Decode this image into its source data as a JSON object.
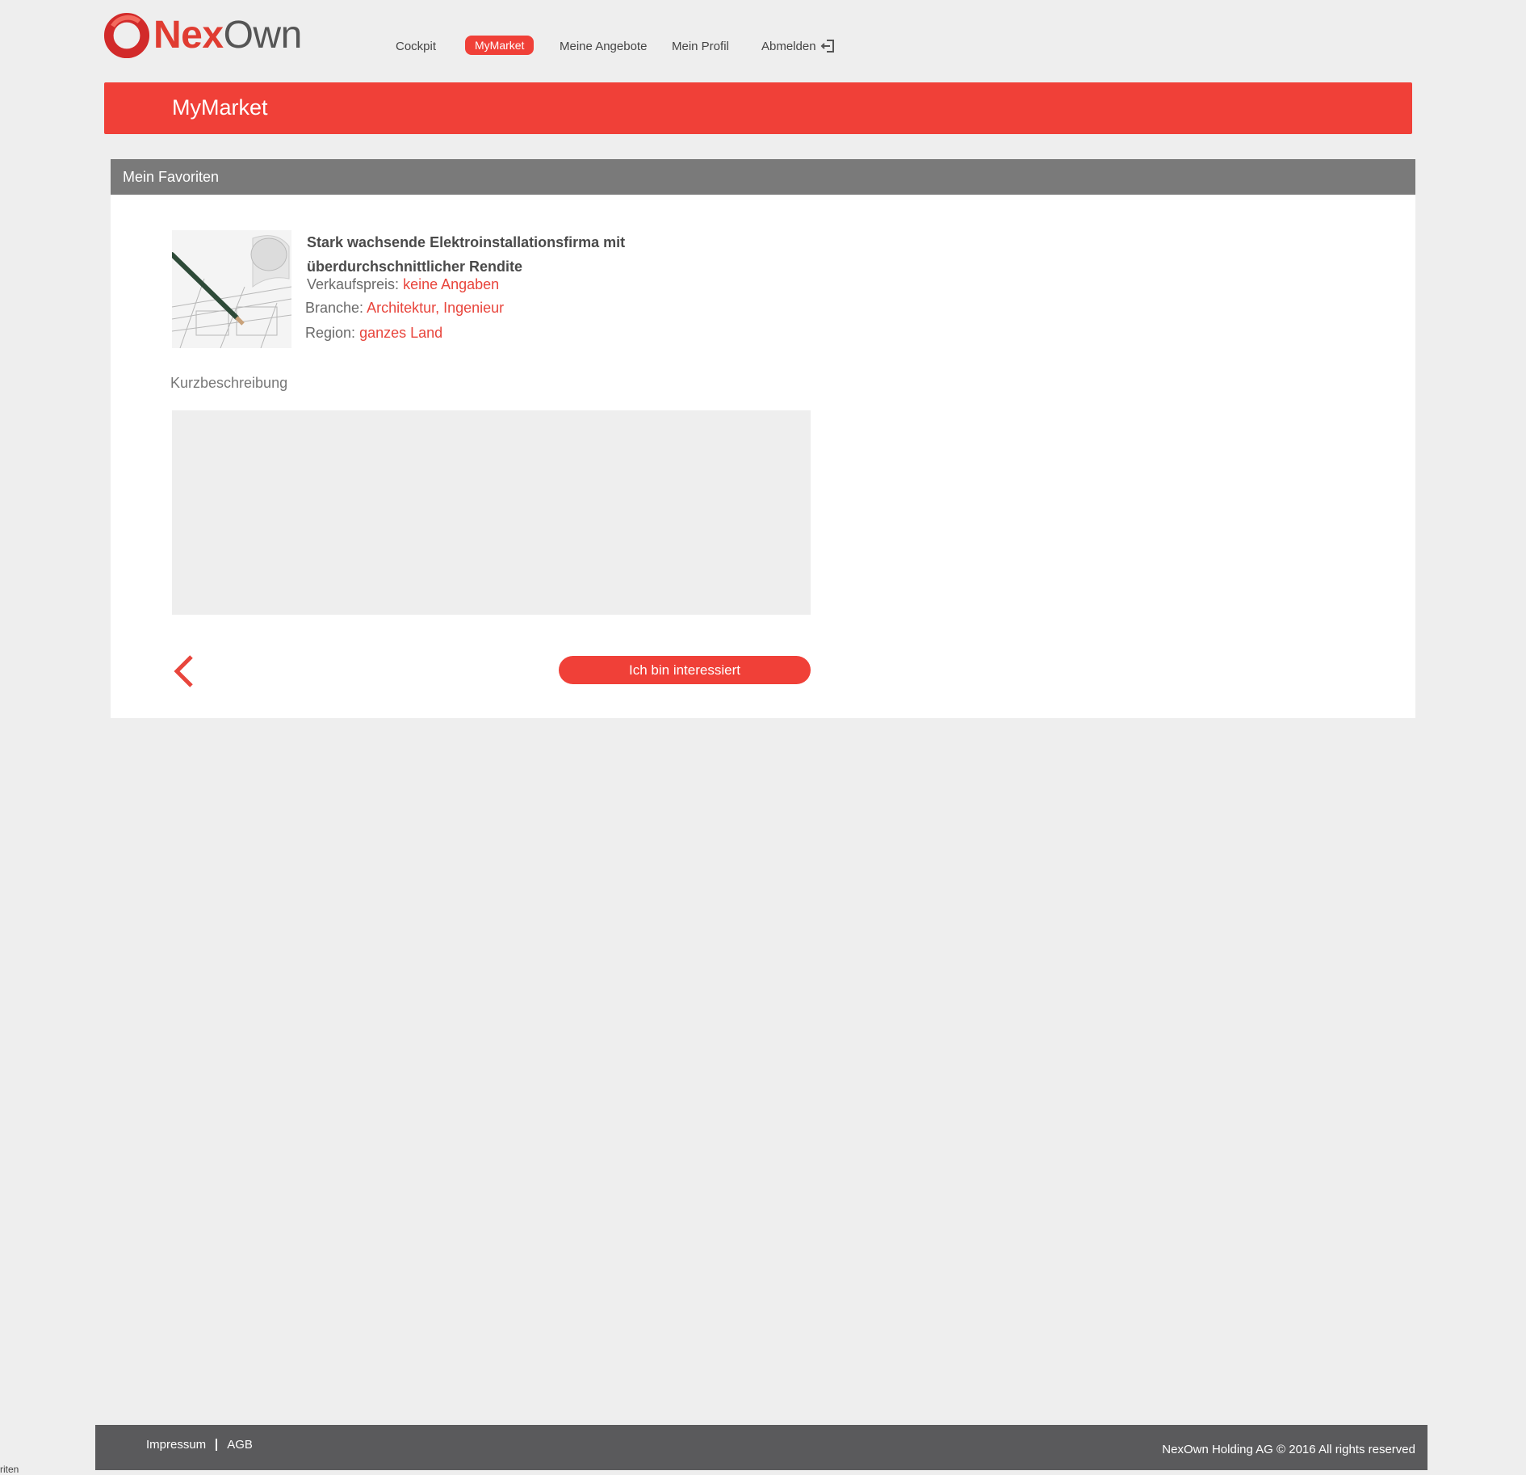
{
  "brand": {
    "part1": "Nex",
    "part2": "Own",
    "accent": "#f04038"
  },
  "nav": {
    "items": [
      {
        "label": "Cockpit"
      },
      {
        "label": "MyMarket",
        "active": true
      },
      {
        "label": "Meine Angebote"
      },
      {
        "label": "Mein Profil"
      },
      {
        "label": "Abmelden",
        "icon": "logout-icon"
      }
    ]
  },
  "banner": {
    "title": "MyMarket"
  },
  "panel": {
    "header": "Mein Favoriten",
    "listing": {
      "title": "Stark wachsende Elektroinstallationsfirma mit überdurchschnittlicher Rendite",
      "fields": [
        {
          "label": "Verkaufspreis:",
          "value": "keine Angaben"
        },
        {
          "label": "Branche:",
          "value": "Architektur, Ingenieur"
        },
        {
          "label": "Region:",
          "value": "ganzes Land"
        }
      ],
      "short_description_label": "Kurzbeschreibung",
      "short_description": ""
    },
    "back_icon": "chevron-left-icon",
    "interest_button": "Ich bin interessiert"
  },
  "footer": {
    "links": [
      {
        "label": "Impressum"
      },
      {
        "label": "AGB"
      }
    ],
    "copyright": "NexOwn Holding AG © 2016 All rights reserved"
  },
  "edge_text": "riten"
}
